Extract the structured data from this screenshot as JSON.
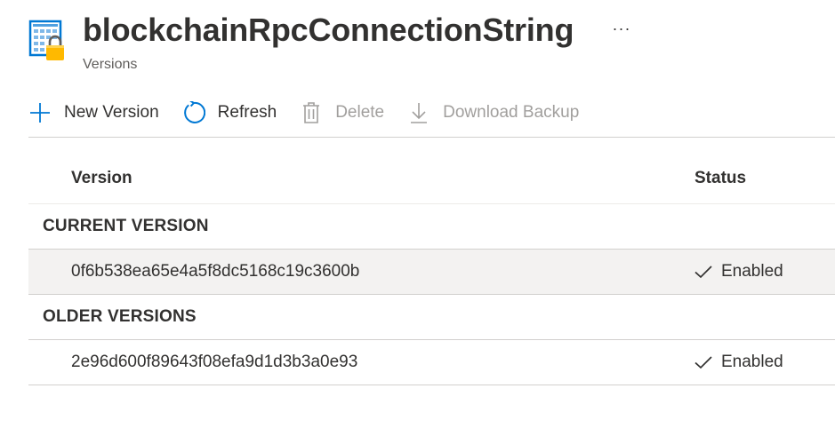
{
  "header": {
    "title": "blockchainRpcConnectionString",
    "subtitle": "Versions",
    "more_label": "···"
  },
  "toolbar": {
    "new_version_label": "New Version",
    "refresh_label": "Refresh",
    "delete_label": "Delete",
    "download_backup_label": "Download Backup"
  },
  "grid": {
    "columns": {
      "version": "Version",
      "status": "Status"
    },
    "groups": [
      {
        "label": "CURRENT VERSION",
        "rows": [
          {
            "version": "0f6b538ea65e4a5f8dc5168c19c3600b",
            "status": "Enabled",
            "selected": true
          }
        ]
      },
      {
        "label": "OLDER VERSIONS",
        "rows": [
          {
            "version": "2e96d600f89643f08efa9d1d3b3a0e93",
            "status": "Enabled",
            "selected": false
          }
        ]
      }
    ]
  },
  "colors": {
    "accent": "#0078d4",
    "text": "#323130",
    "disabled": "#a19f9d",
    "selected_row": "#f3f2f1",
    "lock": "#ffb900"
  },
  "icons": {
    "resource": "key-vault-secret-icon",
    "new_version": "plus-icon",
    "refresh": "refresh-icon",
    "delete": "trash-icon",
    "download": "download-icon",
    "status": "checkmark-icon"
  }
}
